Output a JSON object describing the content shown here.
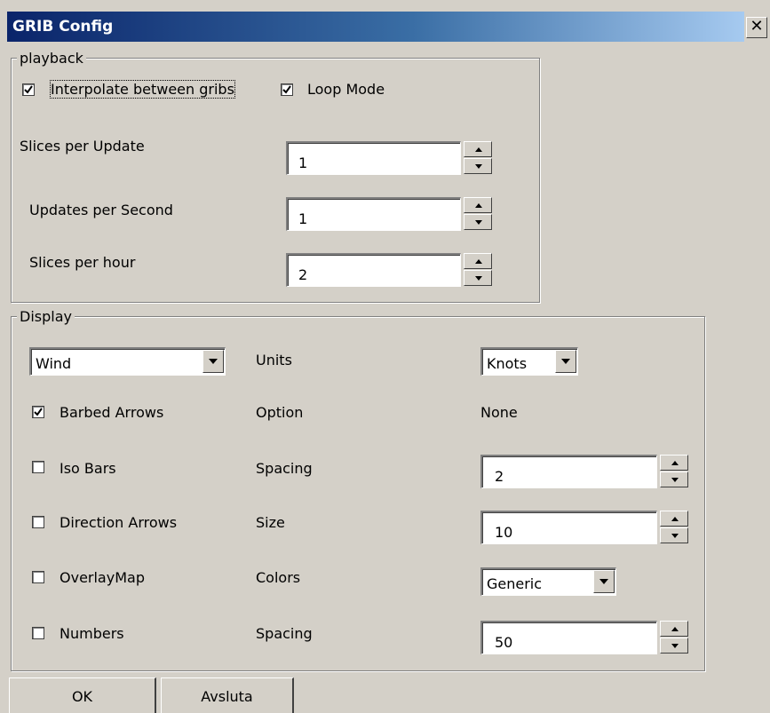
{
  "window": {
    "title": "GRIB Config"
  },
  "playback": {
    "legend": "playback",
    "interpolate_label": "Interpolate between gribs",
    "interpolate_checked": true,
    "loop_label": "Loop Mode",
    "loop_checked": true,
    "slices_per_update_label": "Slices per Update",
    "slices_per_update_value": "1",
    "updates_per_second_label": "Updates per Second",
    "updates_per_second_value": "1",
    "slices_per_hour_label": "Slices per hour",
    "slices_per_hour_value": "2"
  },
  "display": {
    "legend": "Display",
    "type_selected": "Wind",
    "units_label": "Units",
    "units_selected": "Knots",
    "rows": [
      {
        "label": "Barbed Arrows",
        "checked": true,
        "option_label": "Option",
        "value": "None"
      },
      {
        "label": "Iso Bars",
        "checked": false,
        "option_label": "Spacing",
        "value": "2"
      },
      {
        "label": "Direction Arrows",
        "checked": false,
        "option_label": "Size",
        "value": "10"
      },
      {
        "label": "OverlayMap",
        "checked": false,
        "option_label": "Colors",
        "value": "Generic"
      },
      {
        "label": "Numbers",
        "checked": false,
        "option_label": "Spacing",
        "value": "50"
      }
    ]
  },
  "buttons": {
    "ok": "OK",
    "cancel": "Avsluta"
  },
  "icons": {
    "check": "check-icon",
    "arrow_up": "arrow-up-icon",
    "arrow_down": "arrow-down-icon",
    "close": "close-icon"
  }
}
